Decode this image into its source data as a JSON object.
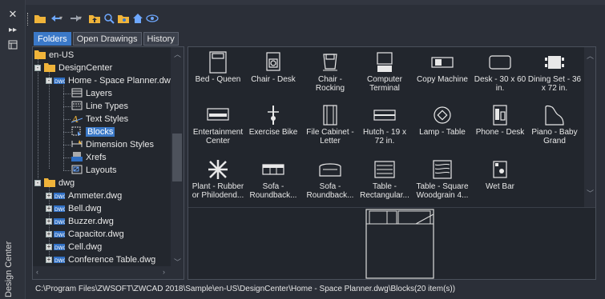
{
  "window": {
    "vertical_title": "Design Center"
  },
  "tabs": [
    {
      "label": "Folders",
      "active": true
    },
    {
      "label": "Open Drawings",
      "active": false
    },
    {
      "label": "History",
      "active": false
    }
  ],
  "tree": {
    "nodes": [
      {
        "label": "en-US",
        "icon": "folder-icon"
      },
      {
        "label": "DesignCenter",
        "icon": "folder-icon"
      },
      {
        "label": "Home - Space Planner.dw",
        "icon": "dwg-icon"
      },
      {
        "label": "Layers",
        "icon": "layers-icon"
      },
      {
        "label": "Line Types",
        "icon": "linetypes-icon"
      },
      {
        "label": "Text Styles",
        "icon": "textstyles-icon"
      },
      {
        "label": "Blocks",
        "icon": "blocks-icon",
        "selected": true
      },
      {
        "label": "Dimension Styles",
        "icon": "dimstyles-icon"
      },
      {
        "label": "Xrefs",
        "icon": "xrefs-icon"
      },
      {
        "label": "Layouts",
        "icon": "layouts-icon"
      },
      {
        "label": "dwg",
        "icon": "folder-icon"
      },
      {
        "label": "Ammeter.dwg",
        "icon": "dwg-icon"
      },
      {
        "label": "Bell.dwg",
        "icon": "dwg-icon"
      },
      {
        "label": "Buzzer.dwg",
        "icon": "dwg-icon"
      },
      {
        "label": "Capacitor.dwg",
        "icon": "dwg-icon"
      },
      {
        "label": "Cell.dwg",
        "icon": "dwg-icon"
      },
      {
        "label": "Conference Table.dwg",
        "icon": "dwg-icon"
      }
    ]
  },
  "blocks": [
    {
      "line1": "Bed - Queen",
      "line2": "",
      "icon": "bed-icon"
    },
    {
      "line1": "Chair - Desk",
      "line2": "",
      "icon": "chair-desk-icon"
    },
    {
      "line1": "Chair -",
      "line2": "Rocking",
      "icon": "chair-rocking-icon"
    },
    {
      "line1": "Computer",
      "line2": "Terminal",
      "icon": "computer-icon"
    },
    {
      "line1": "Copy Machine",
      "line2": "",
      "icon": "copy-machine-icon"
    },
    {
      "line1": "Desk - 30 x 60",
      "line2": "in.",
      "icon": "desk-icon"
    },
    {
      "line1": "Dining Set - 36",
      "line2": "x 72 in.",
      "icon": "dining-set-icon"
    },
    {
      "line1": "Entertainment",
      "line2": "Center",
      "icon": "entertainment-icon"
    },
    {
      "line1": "Exercise Bike",
      "line2": "",
      "icon": "bike-icon"
    },
    {
      "line1": "File Cabinet -",
      "line2": "Letter",
      "icon": "file-cabinet-icon"
    },
    {
      "line1": "Hutch - 19 x",
      "line2": "72 in.",
      "icon": "hutch-icon"
    },
    {
      "line1": "Lamp - Table",
      "line2": "",
      "icon": "lamp-icon"
    },
    {
      "line1": "Phone - Desk",
      "line2": "",
      "icon": "phone-icon"
    },
    {
      "line1": "Piano - Baby",
      "line2": "Grand",
      "icon": "piano-icon"
    },
    {
      "line1": "Plant - Rubber",
      "line2": "or Philodend...",
      "icon": "plant-icon"
    },
    {
      "line1": "Sofa -",
      "line2": "Roundback...",
      "icon": "sofa-icon"
    },
    {
      "line1": "Sofa -",
      "line2": "Roundback...",
      "icon": "sofa2-icon"
    },
    {
      "line1": "Table -",
      "line2": "Rectangular...",
      "icon": "table-rect-icon"
    },
    {
      "line1": "Table - Square",
      "line2": "Woodgrain 4...",
      "icon": "table-square-icon"
    },
    {
      "line1": "Wet Bar",
      "line2": "",
      "icon": "wetbar-icon"
    }
  ],
  "status": {
    "path": "C:\\Program Files\\ZWSOFT\\ZWCAD 2018\\Sample\\en-US\\DesignCenter\\Home - Space Planner.dwg\\Blocks(20 item(s))"
  },
  "colors": {
    "accent": "#3b79c8",
    "folder": "#f0b43a",
    "background": "#2b2f38"
  }
}
